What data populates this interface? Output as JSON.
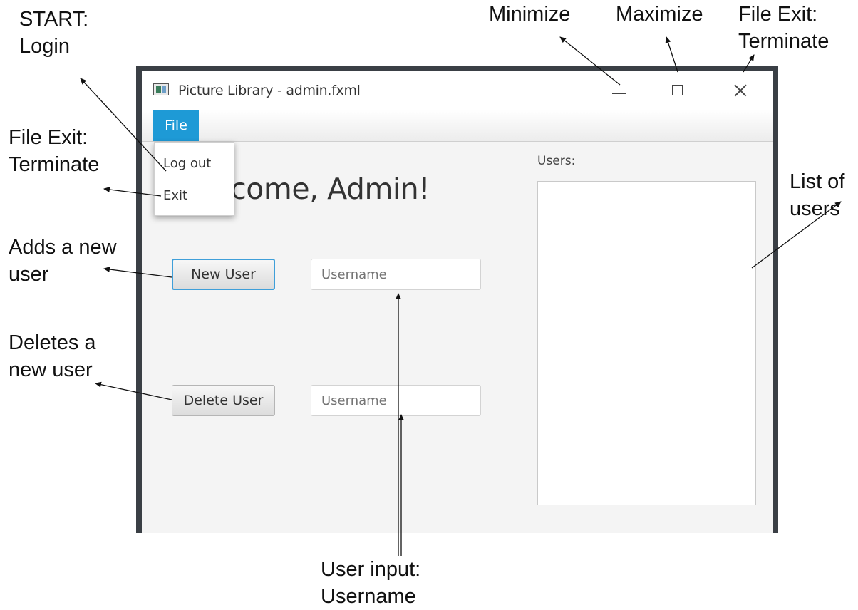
{
  "window": {
    "title": "Picture Library - admin.fxml"
  },
  "menu": {
    "file_label": "File",
    "items": [
      {
        "label": "Log out"
      },
      {
        "label": "Exit"
      }
    ]
  },
  "main": {
    "welcome": "Welcome, Admin!",
    "new_user_button": "New User",
    "delete_user_button": "Delete User",
    "new_username_placeholder": "Username",
    "delete_username_placeholder": "Username",
    "users_label": "Users:"
  },
  "annotations": {
    "start_login": [
      "START:",
      "Login"
    ],
    "file_exit_left": [
      "File Exit:",
      "Terminate"
    ],
    "adds_user": [
      "Adds a new",
      "user"
    ],
    "deletes_user": [
      "Deletes a",
      "new user"
    ],
    "minimize": "Minimize",
    "maximize": "Maximize",
    "file_exit_right": [
      "File Exit:",
      "Terminate"
    ],
    "list_of_users": [
      "List of",
      "users"
    ],
    "user_input": [
      "User input:",
      "Username"
    ]
  }
}
